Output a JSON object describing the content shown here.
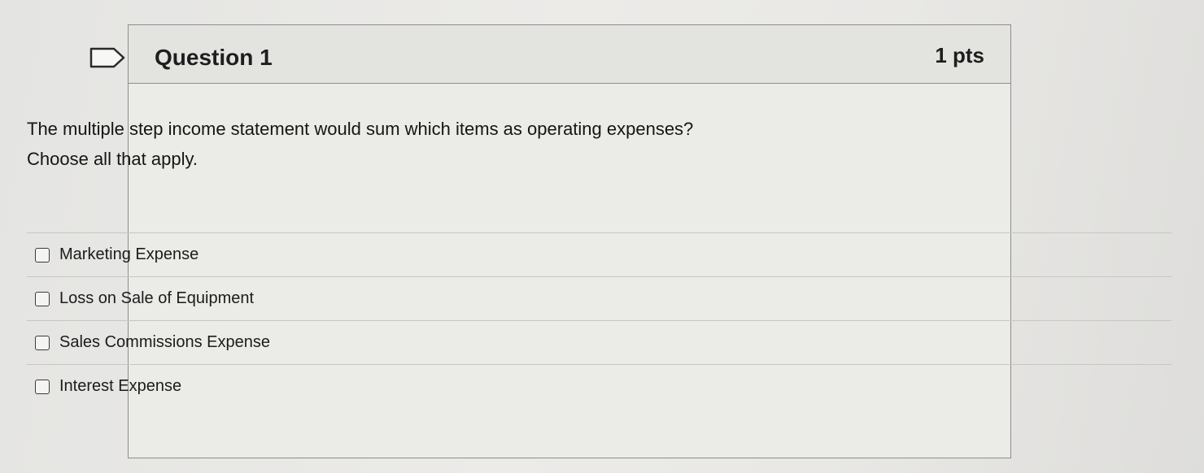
{
  "question": {
    "title": "Question 1",
    "points": "1 pts",
    "prompt_line1": "The multiple step income statement would sum which items as operating expenses?",
    "prompt_line2": "Choose all that apply.",
    "flag_icon": "flag-icon"
  },
  "answers": [
    {
      "label": "Marketing Expense",
      "checked": false
    },
    {
      "label": "Loss on Sale of Equipment",
      "checked": false
    },
    {
      "label": "Sales Commissions Expense",
      "checked": false
    },
    {
      "label": "Interest Expense",
      "checked": false
    }
  ],
  "colors": {
    "border": "#8e8e8c",
    "header_bg": "#e3e3e0",
    "text": "#1e1e1e"
  }
}
